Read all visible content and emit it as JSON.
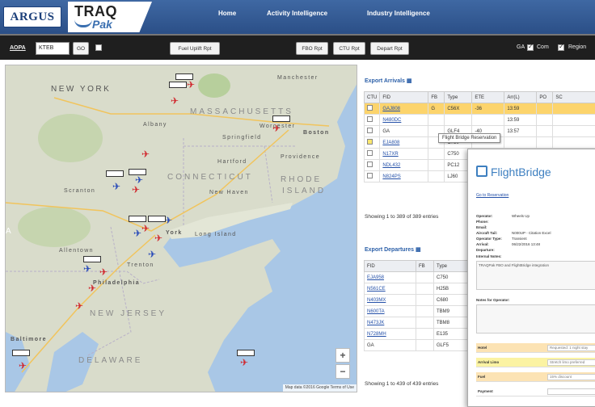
{
  "header": {
    "brand_argus": "ARGUS",
    "brand_traq": "TRAQ",
    "brand_pak": "Pak",
    "nav": [
      "Home",
      "Activity Intelligence",
      "Industry Intelligence"
    ]
  },
  "toolbar": {
    "aopa_label": "AOPA",
    "airport_value": "KTEB",
    "go_label": "GO",
    "fuel_uplift_label": "Fuel Uplift Rpt",
    "fbo_label": "FBO Rpt",
    "ctu_label": "CTU Rpt",
    "depart_label": "Depart Rpt",
    "filters": [
      {
        "label": "GA",
        "checked": true
      },
      {
        "label": "Com",
        "checked": true
      },
      {
        "label": "Region",
        "checked": false
      }
    ]
  },
  "map": {
    "labels": {
      "new_york": "NEW YORK",
      "massachusetts": "MASSACHUSETTS",
      "connecticut": "CONNECTICUT",
      "rhode_island_1": "RHODE",
      "rhode_island_2": "ISLAND",
      "new_jersey": "NEW JERSEY",
      "delaware": "DELAWARE",
      "albany": "Albany",
      "worcester": "Worcester",
      "boston": "Boston",
      "springfield": "Springfield",
      "hartford": "Hartford",
      "providence": "Providence",
      "new_haven": "New Haven",
      "long_island": "Long Island",
      "new_york_city": "York",
      "philadelphia": "Philadelphia",
      "baltimore": "Baltimore",
      "manchester": "Manchester",
      "scranton": "Scranton",
      "allentown": "Allentown",
      "trenton": "Trenton",
      "atlantic": "A"
    },
    "zoom_in": "+",
    "zoom_out": "−",
    "attribution": "Map data ©2016 Google    Terms of Use"
  },
  "arrivals": {
    "title": "Export Arrivals",
    "columns": [
      "CTU",
      "FID",
      "FB",
      "Type",
      "ETE",
      "Arr(L)",
      "PO",
      "SC"
    ],
    "rows": [
      {
        "fid": "GAJ808",
        "fb": "G",
        "type": "C56X",
        "ete": "-36",
        "arr": "13:59",
        "highlight": true,
        "yellow_box": false
      },
      {
        "fid": "N480DC",
        "fb": "",
        "type": "",
        "ete": "",
        "arr": "13:59",
        "highlight": false,
        "yellow_box": false
      },
      {
        "fid": "GA",
        "fb": "",
        "type": "GLF4",
        "ete": "-40",
        "arr": "13:57",
        "highlight": false,
        "yellow_box": false
      },
      {
        "fid": "EJA808",
        "fb": "",
        "type": "C750",
        "ete": "",
        "arr": "",
        "highlight": false,
        "yellow_box": true
      },
      {
        "fid": "N17XR",
        "fb": "",
        "type": "C750",
        "ete": "",
        "arr": "",
        "highlight": false,
        "yellow_box": false
      },
      {
        "fid": "NDL432",
        "fb": "",
        "type": "PC12",
        "ete": "",
        "arr": "",
        "highlight": false,
        "yellow_box": false
      },
      {
        "fid": "N824PS",
        "fb": "",
        "type": "LJ60",
        "ete": "",
        "arr": "",
        "highlight": false,
        "yellow_box": false
      }
    ],
    "footer": "Showing 1 to 389 of 389 entries"
  },
  "tooltip": "Flight Bridge Reservation",
  "departures": {
    "title": "Export Departures",
    "columns": [
      "FID",
      "FB",
      "Type"
    ],
    "rows": [
      {
        "fid": "EJA958",
        "fb": "",
        "type": "C750"
      },
      {
        "fid": "N561CE",
        "fb": "",
        "type": "H25B"
      },
      {
        "fid": "N403MX",
        "fb": "",
        "type": "C680"
      },
      {
        "fid": "N600TA",
        "fb": "",
        "type": "TBM9"
      },
      {
        "fid": "N473JK",
        "fb": "",
        "type": "TBM8"
      },
      {
        "fid": "N728MH",
        "fb": "",
        "type": "E135"
      },
      {
        "fid": "GA",
        "fb": "",
        "type": "GLF5"
      },
      {
        "fid": "EJA135",
        "fb": "",
        "type": ""
      }
    ],
    "footer": "Showing 1 to 439 of 439 entries"
  },
  "flightbridge": {
    "logo": "FlightBridge",
    "link": "Go to Reservation",
    "details": [
      {
        "k": "Operator:",
        "v": "Wheels Up"
      },
      {
        "k": "Phone:",
        "v": ""
      },
      {
        "k": "Email:",
        "v": ""
      },
      {
        "k": "Aircraft Tail:",
        "v": "N000UP - Citation Excel"
      },
      {
        "k": "Operator Type:",
        "v": "Transient"
      },
      {
        "k": "Arrival:",
        "v": "06/22/2016 13:48"
      },
      {
        "k": "Departure:",
        "v": ""
      }
    ],
    "internal_notes_label": "Internal Notes:",
    "internal_notes_text": "TRAQPak FBO and FlightBridge integration",
    "notes_operator_label": "Notes for Operator:",
    "requests": [
      {
        "k": "Hotel",
        "v": "Requested: 1 night stay"
      },
      {
        "k": "Arrival Limo",
        "v": "Stretch limo preferred"
      },
      {
        "k": "Fuel",
        "v": "15% discount"
      },
      {
        "k": "Payment",
        "v": ""
      }
    ]
  }
}
